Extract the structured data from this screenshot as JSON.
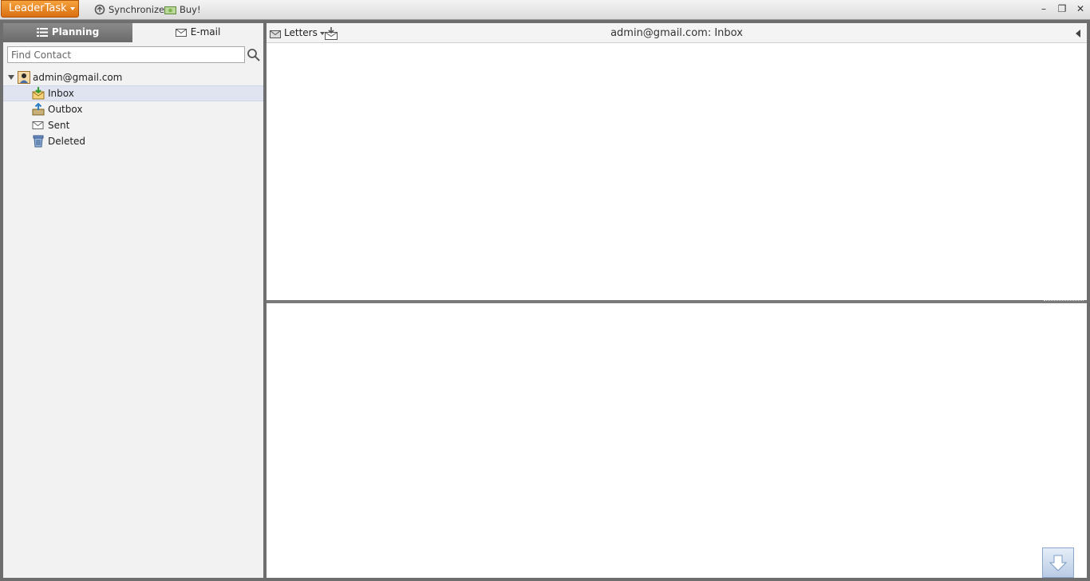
{
  "titlebar": {
    "app_name": "LeaderTask",
    "sync_label": "Synchronize",
    "buy_label": "Buy!",
    "minimize": "–",
    "restore": "❐",
    "close": "✕"
  },
  "sidebar": {
    "tabs": [
      {
        "label": "Planning",
        "active": false,
        "icon": "planning-list-icon"
      },
      {
        "label": "E-mail",
        "active": true,
        "icon": "envelope-icon"
      }
    ],
    "search": {
      "placeholder": "Find Contact",
      "value": ""
    },
    "account": {
      "label": "admin@gmail.com",
      "icon": "account-icon",
      "expanded": true
    },
    "folders": [
      {
        "label": "Inbox",
        "icon": "inbox-icon",
        "selected": true
      },
      {
        "label": "Outbox",
        "icon": "outbox-icon",
        "selected": false
      },
      {
        "label": "Sent",
        "icon": "sent-icon",
        "selected": false
      },
      {
        "label": "Deleted",
        "icon": "deleted-icon",
        "selected": false
      }
    ]
  },
  "mail": {
    "letters_label": "Letters",
    "title": "admin@gmail.com: Inbox"
  },
  "colors": {
    "accent_orange": "#e8841f",
    "tab_active_dark": "#7a7a7a",
    "selection": "#dfe4f0"
  }
}
